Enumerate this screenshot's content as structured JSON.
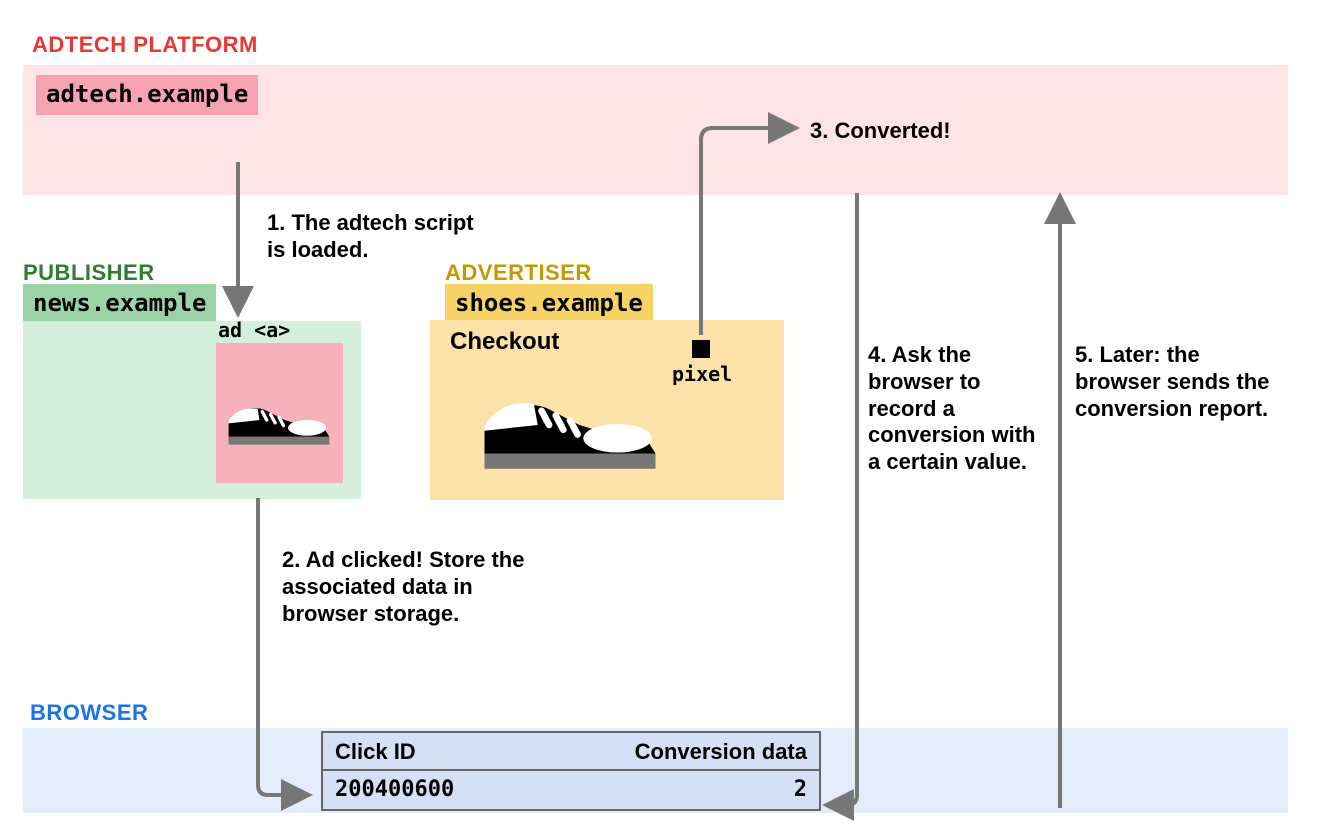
{
  "adtech": {
    "title": "ADTECH PLATFORM",
    "domain": "adtech.example"
  },
  "publisher": {
    "title": "PUBLISHER",
    "domain": "news.example",
    "ad_label": "ad <a>"
  },
  "advertiser": {
    "title": "ADVERTISER",
    "domain": "shoes.example",
    "page_label": "Checkout",
    "pixel_label": "pixel"
  },
  "browser": {
    "title": "BROWSER",
    "storage": {
      "header_click_id": "Click ID",
      "header_conversion": "Conversion data",
      "click_id": "200400600",
      "conversion_value": "2"
    }
  },
  "steps": {
    "s1": "1. The adtech script is loaded.",
    "s2": "2. Ad clicked! Store the associated data in browser storage.",
    "s3": "3. Converted!",
    "s4": "4. Ask the browser to record a conversion with a certain value.",
    "s5": "5. Later: the browser sends the conversion report."
  }
}
